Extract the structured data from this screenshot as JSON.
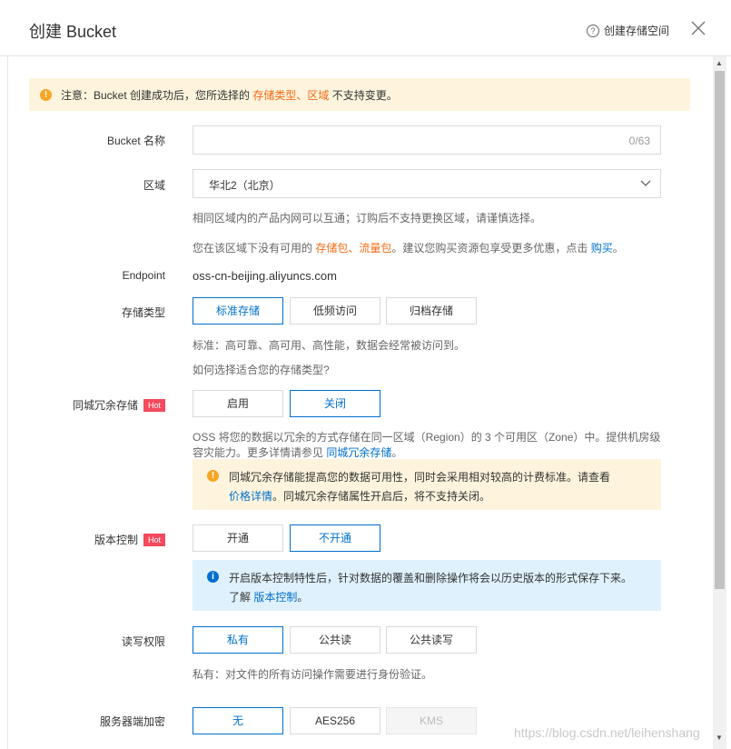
{
  "header": {
    "title": "创建 Bucket",
    "help_label": "创建存储空间",
    "help_icon": "question-circle-icon",
    "close_icon": "close-icon"
  },
  "notice": {
    "prefix": "注意：Bucket 创建成功后，您所选择的 ",
    "link1": "存储类型",
    "sep": "、",
    "link2": "区域",
    "suffix": " 不支持变更。"
  },
  "bucket_name": {
    "label": "Bucket 名称",
    "value": "",
    "counter": "0/63"
  },
  "region": {
    "label": "区域",
    "value": "华北2（北京）",
    "help1": "相同区域内的产品内网可以互通；订购后不支持更换区域，请谨慎选择。",
    "help2_prefix": "您在该区域下没有可用的 ",
    "help2_link1": "存储包",
    "help2_sep": "、",
    "help2_link2": "流量包",
    "help2_mid": "。建议您购买资源包享受更多优惠，点击 ",
    "help2_link3": "购买",
    "help2_suffix": "。"
  },
  "endpoint": {
    "label": "Endpoint",
    "value": "oss-cn-beijing.aliyuncs.com"
  },
  "storage_class": {
    "label": "存储类型",
    "options": [
      "标准存储",
      "低频访问",
      "归档存储"
    ],
    "selected": "标准存储",
    "desc": "标准：高可靠、高可用、高性能，数据会经常被访问到。",
    "link": "如何选择适合您的存储类型?"
  },
  "zone_redundancy": {
    "label": "同城冗余存储",
    "badge": "Hot",
    "options": [
      "启用",
      "关闭"
    ],
    "selected": "关闭",
    "desc1": "OSS 将您的数据以冗余的方式存储在同一区域（Region）的 3 个可用区（Zone）中。提供机房级",
    "desc2_prefix": "容灾能力。更多详情请参见 ",
    "desc2_link": "同城冗余存储",
    "desc2_suffix": "。",
    "tip1": "同城冗余存储能提高您的数据可用性，同时会采用相对较高的计费标准。请查看",
    "tip2_link": "价格详情",
    "tip2_suffix": "。同城冗余存储属性开启后，将不支持关闭。"
  },
  "versioning": {
    "label": "版本控制",
    "badge": "Hot",
    "options": [
      "开通",
      "不开通"
    ],
    "selected": "不开通",
    "tip1": "开启版本控制特性后，针对数据的覆盖和删除操作将会以历史版本的形式保存下来。",
    "tip2_prefix": "了解 ",
    "tip2_link": "版本控制",
    "tip2_suffix": "。"
  },
  "acl": {
    "label": "读写权限",
    "options": [
      "私有",
      "公共读",
      "公共读写"
    ],
    "selected": "私有",
    "desc": "私有：对文件的所有访问操作需要进行身份验证。"
  },
  "encryption": {
    "label": "服务器端加密",
    "options": [
      "无",
      "AES256",
      "KMS"
    ],
    "selected": "无",
    "disabled": "KMS"
  },
  "watermark": "https://blog.csdn.net/leihenshang",
  "colors": {
    "accent": "#0070cc",
    "link_orange": "#f46b16",
    "hot_badge": "#f5495e",
    "warn_bg": "#fef4dd",
    "info_bg": "#dff1fd"
  }
}
